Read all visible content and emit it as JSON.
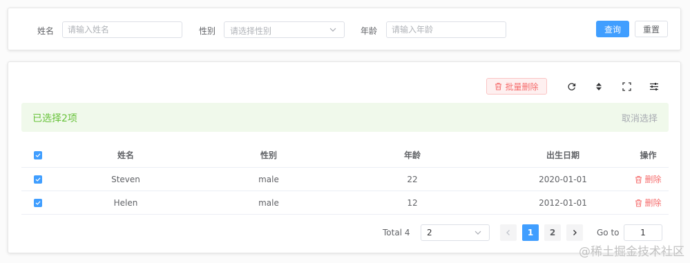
{
  "search": {
    "name_label": "姓名",
    "name_placeholder": "请输入姓名",
    "gender_label": "性别",
    "gender_placeholder": "请选择性别",
    "age_label": "年龄",
    "age_placeholder": "请输入年龄",
    "query_button": "查询",
    "reset_button": "重置"
  },
  "toolbar": {
    "batch_delete": "批量删除",
    "icons": [
      "refresh-icon",
      "sort-icon",
      "fullscreen-icon",
      "column-settings-icon"
    ]
  },
  "alert": {
    "selected_text": "已选择2项",
    "cancel_selection": "取消选择"
  },
  "table": {
    "headers": {
      "name": "姓名",
      "gender": "性别",
      "age": "年龄",
      "birth": "出生日期",
      "op": "操作"
    },
    "rows": [
      {
        "checked": true,
        "name": "Steven",
        "gender": "male",
        "age": "22",
        "birth": "2020-01-01",
        "op": "删除"
      },
      {
        "checked": true,
        "name": "Helen",
        "gender": "male",
        "age": "12",
        "birth": "2012-01-01",
        "op": "删除"
      }
    ]
  },
  "pagination": {
    "total": "Total 4",
    "page_size": "2",
    "pages": [
      "1",
      "2"
    ],
    "current": "1",
    "goto_label": "Go to",
    "goto_value": "1"
  },
  "watermark": "@稀土掘金技术社区",
  "colors": {
    "primary": "#409eff",
    "danger": "#f56c6c",
    "success": "#67c23a"
  }
}
